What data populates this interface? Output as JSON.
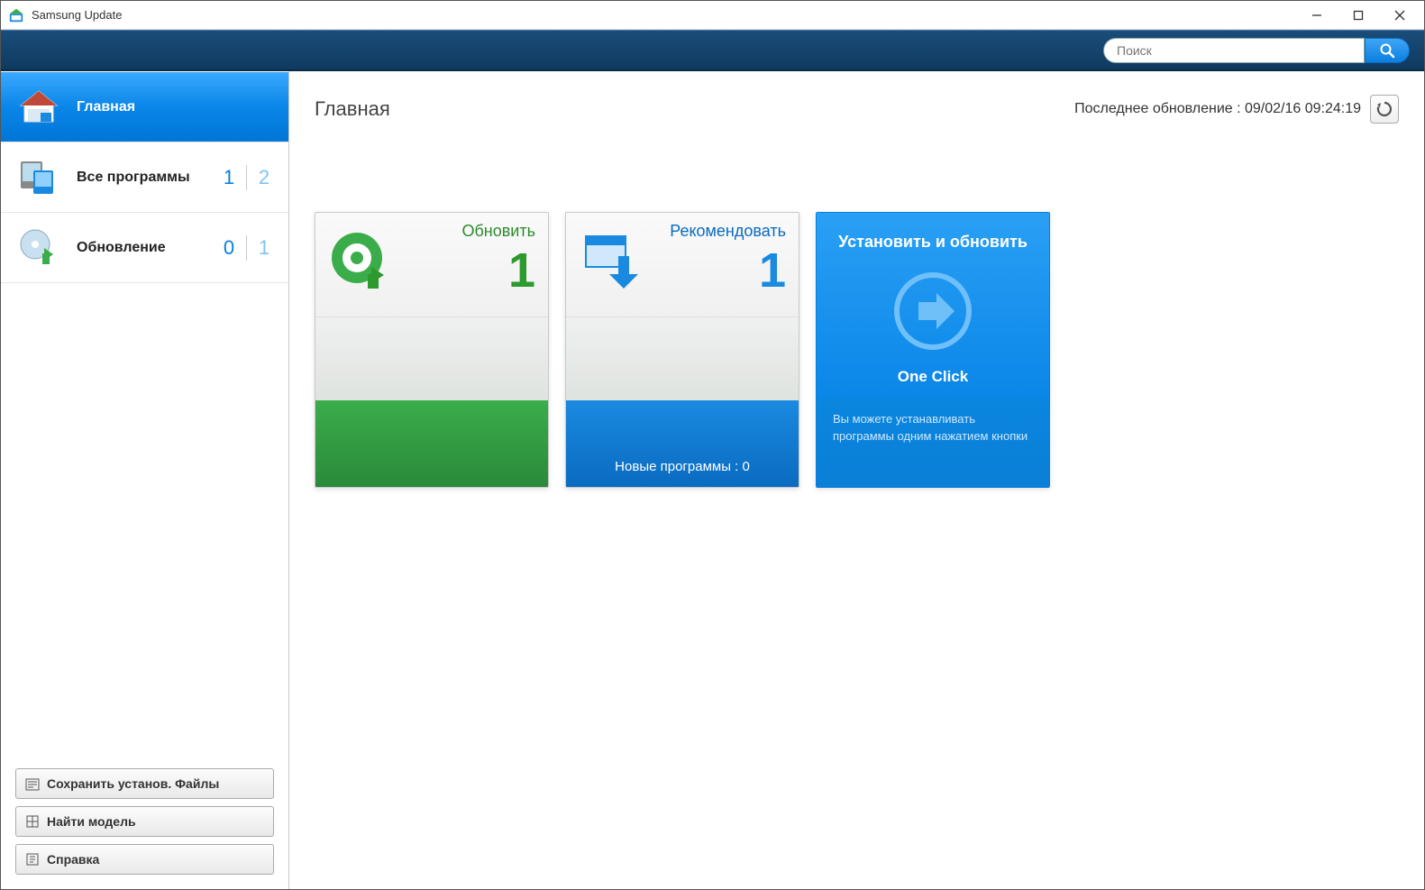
{
  "window": {
    "title": "Samsung Update"
  },
  "search": {
    "placeholder": "Поиск"
  },
  "sidebar": {
    "items": [
      {
        "label": "Главная"
      },
      {
        "label": "Все программы",
        "count_a": "1",
        "count_b": "2"
      },
      {
        "label": "Обновление",
        "count_a": "0",
        "count_b": "1"
      }
    ],
    "actions": {
      "save_files": "Сохранить установ. Файлы",
      "find_model": "Найти модель",
      "help": "Справка"
    }
  },
  "main": {
    "title": "Главная",
    "last_update_label": "Последнее обновление : 09/02/16 09:24:19"
  },
  "cards": {
    "update": {
      "title": "Обновить",
      "count": "1"
    },
    "recommend": {
      "title": "Рекомендовать",
      "count": "1",
      "new_programs": "Новые программы : 0"
    },
    "install": {
      "title": "Установить и обновить",
      "one_click": "One Click",
      "desc": "Вы можете устанавливать программы одним нажатием кнопки"
    }
  }
}
